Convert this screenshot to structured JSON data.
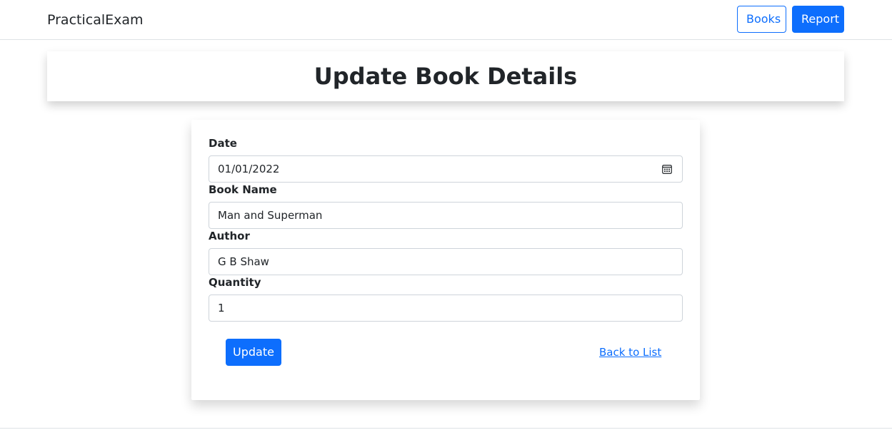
{
  "navbar": {
    "brand": "PracticalExam",
    "books_label": "Books",
    "report_label": "Report"
  },
  "page": {
    "title": "Update Book Details"
  },
  "form": {
    "date": {
      "label": "Date",
      "value": "01/01/2022",
      "icon": "calendar-icon"
    },
    "book_name": {
      "label": "Book Name",
      "value": "Man and Superman"
    },
    "author": {
      "label": "Author",
      "value": "G B Shaw"
    },
    "quantity": {
      "label": "Quantity",
      "value": "1"
    },
    "update_label": "Update",
    "back_label": "Back to List"
  },
  "colors": {
    "primary": "#0d6efd",
    "text": "#212529",
    "border": "#ced4da"
  }
}
